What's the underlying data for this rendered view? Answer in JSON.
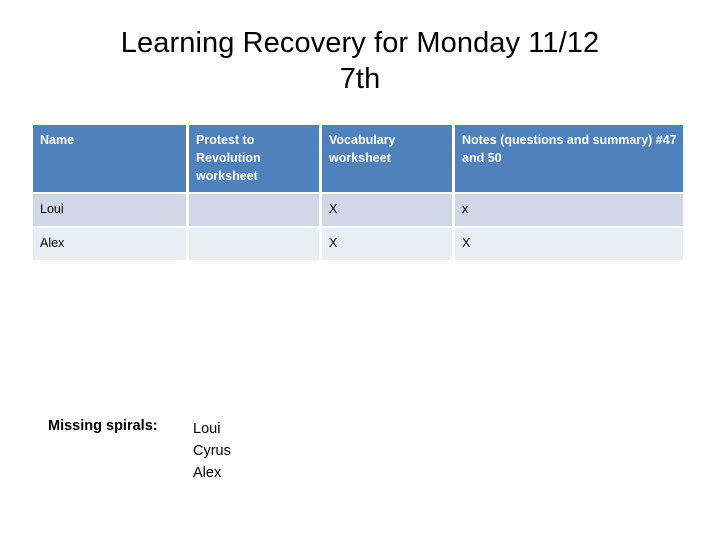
{
  "slide": {
    "title_lines": [
      "Learning Recovery for Monday 11/12",
      "7th"
    ]
  },
  "table": {
    "columns": [
      "Name",
      "Protest to Revolution worksheet",
      "Vocabulary worksheet",
      "Notes (questions and summary) #47 and 50"
    ],
    "rows": [
      {
        "name": "Loui",
        "protest": "",
        "vocabulary": "X",
        "notes": "x"
      },
      {
        "name": "Alex",
        "protest": "",
        "vocabulary": "X",
        "notes": "X"
      }
    ],
    "colors": {
      "header_fill": "#4F81BD",
      "header_text": "#FFFFFF",
      "row_band_a": "#D0D8E8",
      "row_band_b": "#E9EDF4",
      "gridline": "#FFFFFF"
    }
  },
  "missing_spirals": {
    "label": "Missing spirals:",
    "names": [
      "Loui",
      "Cyrus",
      "Alex"
    ]
  }
}
